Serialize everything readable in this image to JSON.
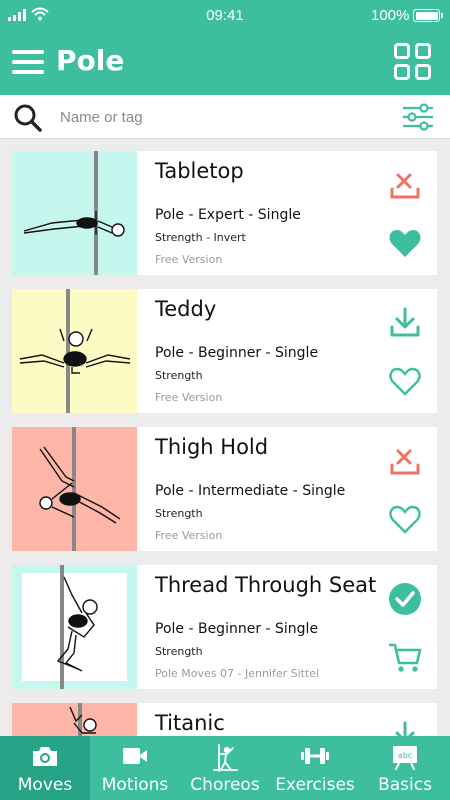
{
  "status": {
    "time": "09:41",
    "battery": "100%"
  },
  "header": {
    "title": "Pole"
  },
  "search": {
    "placeholder": "Name or tag"
  },
  "colors": {
    "brand": "#3dbf9f",
    "brand_dark": "#27a487",
    "heart": "#3dbf9f",
    "remove": "#f07264"
  },
  "moves": [
    {
      "title": "Tabletop",
      "line1": "Pole - Expert - Single",
      "line2": "Strength - Invert",
      "line3": "Free Version",
      "bg": "#c6f7ee",
      "top_action": "remove-download-icon",
      "bottom_action": "heart-filled-icon"
    },
    {
      "title": "Teddy",
      "line1": "Pole - Beginner - Single",
      "line2": "Strength",
      "line3": "Free Version",
      "bg": "#fdfbc4",
      "top_action": "download-icon",
      "bottom_action": "heart-outline-icon"
    },
    {
      "title": "Thigh Hold",
      "line1": "Pole - Intermediate - Single",
      "line2": "Strength",
      "line3": "Free Version",
      "bg": "#fdb6a8",
      "top_action": "remove-download-icon",
      "bottom_action": "heart-outline-icon"
    },
    {
      "title": "Thread Through Seat",
      "line1": "Pole - Beginner - Single",
      "line2": "Strength",
      "line3": "Pole Moves 07 - Jennifer Sittel",
      "bg": "#c6f7ee",
      "top_action": "checkmark-circle-icon",
      "bottom_action": "cart-icon"
    },
    {
      "title": "Titanic",
      "line1": "",
      "line2": "",
      "line3": "",
      "bg": "#fdb6a8",
      "top_action": "download-icon",
      "bottom_action": ""
    }
  ],
  "tabs": [
    {
      "label": "Moves",
      "icon": "camera-icon",
      "active": true
    },
    {
      "label": "Motions",
      "icon": "video-camera-icon",
      "active": false
    },
    {
      "label": "Choreos",
      "icon": "dancer-icon",
      "active": false
    },
    {
      "label": "Exercises",
      "icon": "dumbbell-icon",
      "active": false
    },
    {
      "label": "Basics",
      "icon": "chalkboard-icon",
      "active": false
    }
  ]
}
